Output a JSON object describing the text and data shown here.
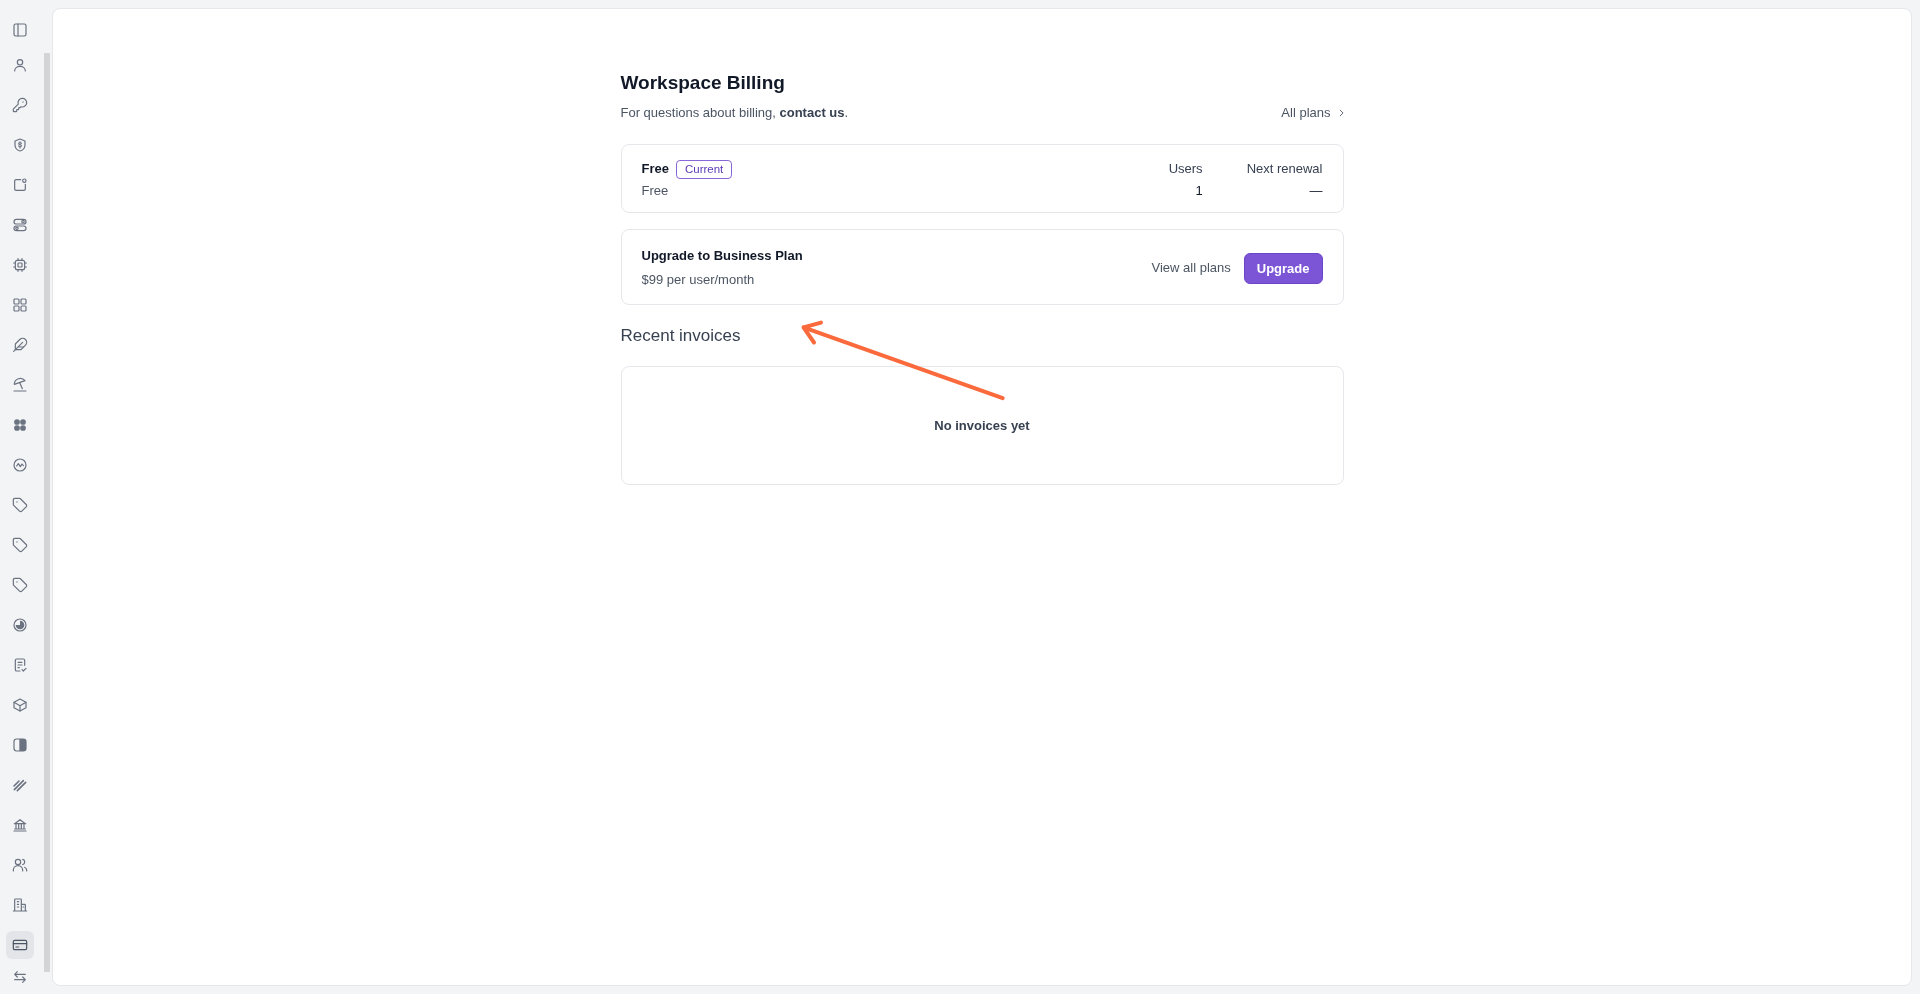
{
  "sidebar": {
    "items": [
      {
        "selected": false
      },
      {
        "selected": false
      },
      {
        "selected": false
      },
      {
        "selected": false
      },
      {
        "selected": false
      },
      {
        "selected": false
      },
      {
        "selected": false
      },
      {
        "selected": false
      },
      {
        "selected": false
      },
      {
        "selected": false
      },
      {
        "selected": false
      },
      {
        "selected": false
      },
      {
        "selected": false
      },
      {
        "selected": false
      },
      {
        "selected": false
      },
      {
        "selected": false
      },
      {
        "selected": false
      },
      {
        "selected": false
      },
      {
        "selected": false
      },
      {
        "selected": false
      },
      {
        "selected": false
      },
      {
        "selected": false
      },
      {
        "selected": true
      }
    ],
    "footer_item": {
      "selected": false
    }
  },
  "header": {
    "title": "Workspace Billing",
    "subtitle": {
      "text": "For questions about billing, ",
      "link": "contact us",
      "end": "."
    },
    "all_plans_link": "All plans"
  },
  "current_plan": {
    "name": "Free",
    "badge": "Current",
    "price": "Free",
    "stats": [
      {
        "label": "Users",
        "value": "1"
      },
      {
        "label": "Next renewal",
        "value": "—"
      }
    ]
  },
  "upgrade": {
    "title": "Upgrade to Business Plan",
    "price": "$99 per user/month",
    "secondary_action": "View all plans",
    "primary_action": "Upgrade"
  },
  "invoices": {
    "heading": "Recent invoices",
    "empty_message": "No invoices yet"
  }
}
